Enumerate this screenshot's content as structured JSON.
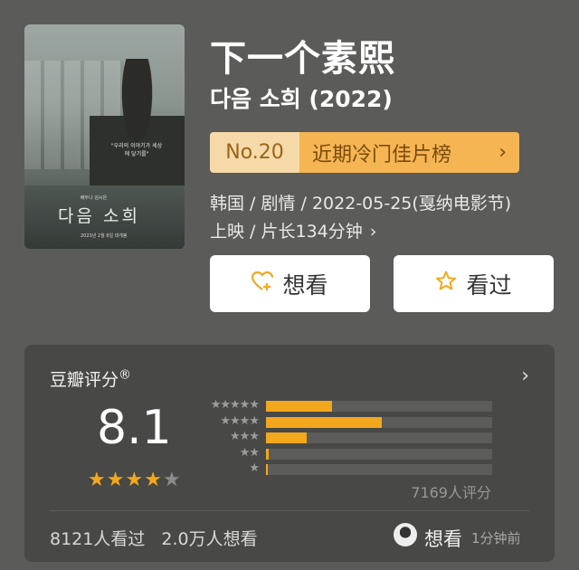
{
  "poster": {
    "title": "다음 소희",
    "quote": "\"우리의 이야기가 세상에 닿기를\"",
    "caption": "배두나 김시은",
    "bottom": "2023년 2월 8일 대개봉"
  },
  "movie": {
    "title": "下一个素熙",
    "original_title": "다음 소희 (2022)",
    "rank_no": "No.20",
    "rank_list": "近期冷门佳片榜",
    "rank_chevron": "›",
    "meta_line1": "韩国 / 剧情 / 2022-05-25(戛纳电影节)",
    "meta_line2": "上映 / 片长134分钟",
    "meta_more": "›"
  },
  "actions": {
    "want_label": "想看",
    "want_icon": "heart-plus-icon",
    "seen_label": "看过",
    "seen_icon": "star-outline-icon"
  },
  "rating": {
    "title": "豆瓣评分",
    "registered": "®",
    "score": "8.1",
    "stars": 4,
    "count_label": "7169人评分",
    "distribution": [
      {
        "stars": 5,
        "fraction": 0.29
      },
      {
        "stars": 4,
        "fraction": 0.51
      },
      {
        "stars": 3,
        "fraction": 0.18
      },
      {
        "stars": 2,
        "fraction": 0.01
      },
      {
        "stars": 1,
        "fraction": 0.005
      }
    ],
    "accent": "#f3a71d"
  },
  "footer": {
    "seen_count": "8121人看过",
    "want_count": "2.0万人想看",
    "friend_action": "想看",
    "friend_time": "1分钟前"
  }
}
